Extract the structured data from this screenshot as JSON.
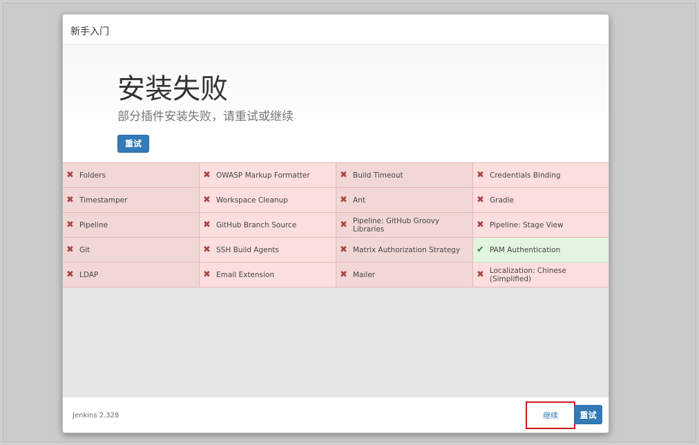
{
  "dialog": {
    "title": "新手入门",
    "heading": "安装失败",
    "subtitle": "部分插件安装失败，请重试或继续",
    "retry_label": "重试"
  },
  "plugins": [
    {
      "name": "Folders",
      "status": "failed"
    },
    {
      "name": "OWASP Markup Formatter",
      "status": "failed"
    },
    {
      "name": "Build Timeout",
      "status": "failed"
    },
    {
      "name": "Credentials Binding",
      "status": "failed"
    },
    {
      "name": "Timestamper",
      "status": "failed"
    },
    {
      "name": "Workspace Cleanup",
      "status": "failed"
    },
    {
      "name": "Ant",
      "status": "failed"
    },
    {
      "name": "Gradle",
      "status": "failed"
    },
    {
      "name": "Pipeline",
      "status": "failed"
    },
    {
      "name": "GitHub Branch Source",
      "status": "failed"
    },
    {
      "name": "Pipeline: GitHub Groovy Libraries",
      "status": "failed"
    },
    {
      "name": "Pipeline: Stage View",
      "status": "failed"
    },
    {
      "name": "Git",
      "status": "failed"
    },
    {
      "name": "SSH Build Agents",
      "status": "failed"
    },
    {
      "name": "Matrix Authorization Strategy",
      "status": "failed"
    },
    {
      "name": "PAM Authentication",
      "status": "success"
    },
    {
      "name": "LDAP",
      "status": "failed"
    },
    {
      "name": "Email Extension",
      "status": "failed"
    },
    {
      "name": "Mailer",
      "status": "failed"
    },
    {
      "name": "Localization: Chinese (Simplified)",
      "status": "failed"
    }
  ],
  "icons": {
    "failed": "cross-icon",
    "success": "check-icon"
  },
  "colors": {
    "failed_bg": "#f2d7d7",
    "success_bg": "#e2f5de",
    "accent": "#337ab7"
  },
  "footer": {
    "version": "Jenkins 2.328",
    "continue_label": "继续",
    "retry_label": "重试"
  }
}
